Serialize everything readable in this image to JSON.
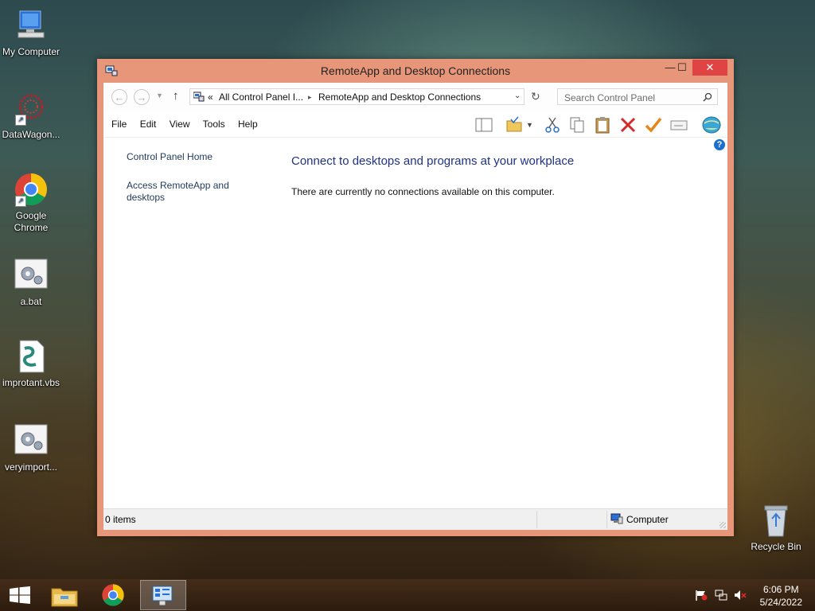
{
  "desktop": {
    "icons": [
      {
        "label": "My Computer"
      },
      {
        "label": "DataWagon..."
      },
      {
        "label": "Google Chrome"
      },
      {
        "label": "a.bat"
      },
      {
        "label": "improtant.vbs"
      },
      {
        "label": "veryimport..."
      },
      {
        "label": "Recycle Bin"
      }
    ]
  },
  "window": {
    "title": "RemoteApp and Desktop Connections",
    "controls": {
      "minimize": "—",
      "maximize": "☐",
      "close": "✕"
    },
    "address": {
      "chevron": "«",
      "crumb1": "All Control Panel I...",
      "separator": "▸",
      "crumb2": "RemoteApp and Desktop Connections"
    },
    "search": {
      "placeholder": "Search Control Panel"
    },
    "menu": [
      "File",
      "Edit",
      "View",
      "Tools",
      "Help"
    ],
    "sidebar": {
      "home": "Control Panel Home",
      "access": "Access RemoteApp and desktops"
    },
    "content": {
      "heading": "Connect to desktops and programs at your workplace",
      "message": "There are currently no connections available on this computer."
    },
    "status": {
      "items": "0 items",
      "zone": "Computer"
    }
  },
  "taskbar": {
    "time": "6:06 PM",
    "date": "5/24/2022"
  },
  "colors": {
    "window_frame": "#e8967a",
    "close_button": "#e04343",
    "heading": "#1e3287",
    "link": "#1e395b"
  }
}
